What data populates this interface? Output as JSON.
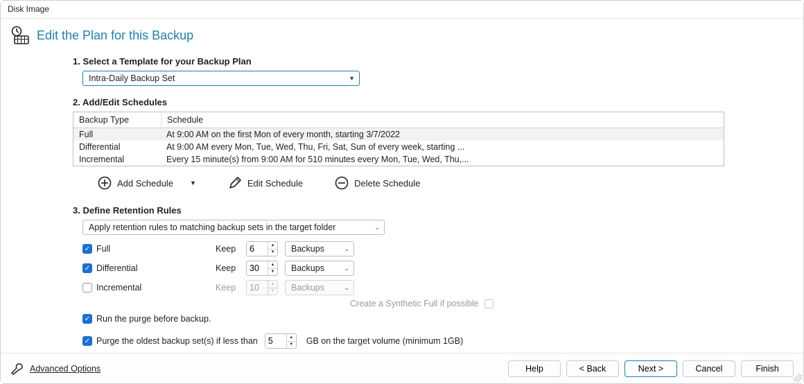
{
  "window": {
    "title": "Disk Image"
  },
  "header": {
    "title": "Edit the Plan for this Backup"
  },
  "step1": {
    "heading": "1. Select a Template for your Backup Plan",
    "template_selected": "Intra-Daily Backup Set"
  },
  "step2": {
    "heading": "2. Add/Edit Schedules",
    "columns": {
      "type": "Backup Type",
      "schedule": "Schedule"
    },
    "rows": [
      {
        "type": "Full",
        "schedule": "At 9:00 AM on the first Mon of every month, starting 3/7/2022"
      },
      {
        "type": "Differential",
        "schedule": "At 9:00 AM every Mon, Tue, Wed, Thu, Fri, Sat, Sun of every week, starting ..."
      },
      {
        "type": "Incremental",
        "schedule": "Every 15 minute(s) from 9:00 AM for 510 minutes every Mon, Tue, Wed, Thu,..."
      }
    ],
    "buttons": {
      "add": "Add Schedule",
      "edit": "Edit Schedule",
      "delete": "Delete Schedule"
    }
  },
  "step3": {
    "heading": "3. Define Retention Rules",
    "scope_selected": "Apply retention rules to matching backup sets in the target folder",
    "keep_label": "Keep",
    "unit_selected": "Backups",
    "rows": {
      "full": {
        "label": "Full",
        "value": "6",
        "enabled": true
      },
      "differential": {
        "label": "Differential",
        "value": "30",
        "enabled": true
      },
      "incremental": {
        "label": "Incremental",
        "value": "10",
        "enabled": false
      }
    },
    "synthetic_label": "Create a Synthetic Full if possible",
    "run_purge_label": "Run the purge before backup.",
    "purge_oldest_prefix": "Purge the oldest backup set(s) if less than",
    "purge_oldest_value": "5",
    "purge_oldest_suffix": "GB on the target volume (minimum 1GB)"
  },
  "footer": {
    "advanced": "Advanced Options",
    "help": "Help",
    "back": "<  Back",
    "next": "Next  >",
    "cancel": "Cancel",
    "finish": "Finish"
  }
}
